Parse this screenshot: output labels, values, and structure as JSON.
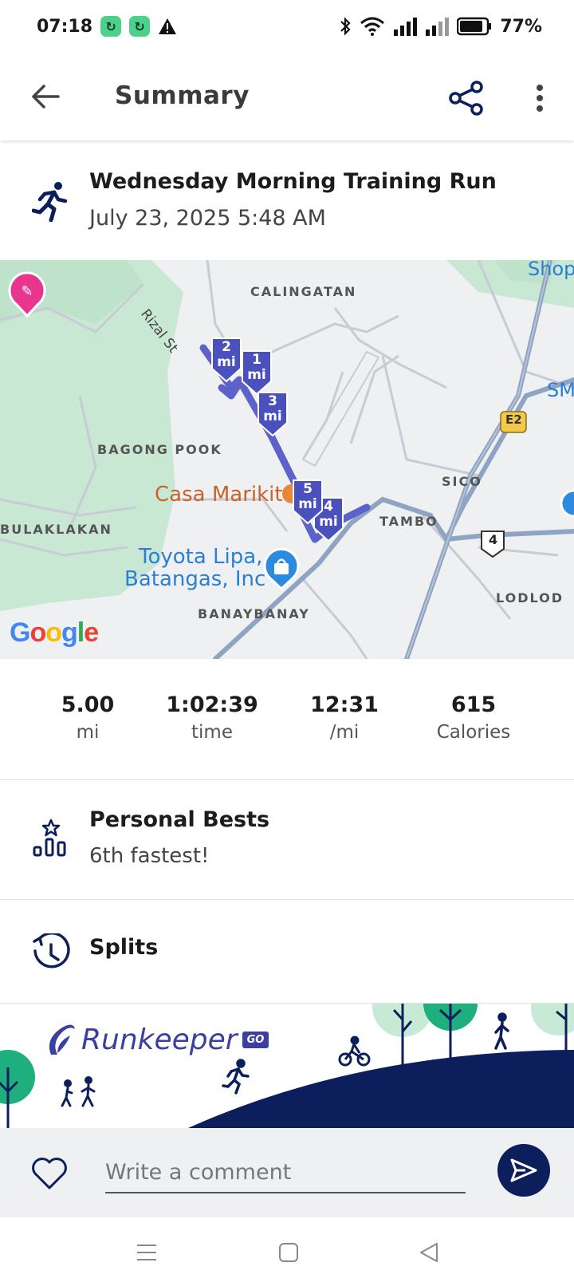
{
  "status_bar": {
    "time": "07:18",
    "battery": "77%",
    "icons": [
      "app-badge-icon",
      "app-badge-icon",
      "warning-icon",
      "bluetooth-icon",
      "wifi-icon",
      "signal-icon",
      "signal-icon",
      "battery-icon"
    ]
  },
  "app_bar": {
    "title": "Summary",
    "icons": [
      "back-arrow-icon",
      "share-icon",
      "more-vert-icon"
    ]
  },
  "activity": {
    "title": "Wednesday Morning Training Run",
    "date": "July 23, 2025 5:48 AM",
    "icon": "running-person-icon"
  },
  "map": {
    "labels": {
      "calingatan": "CALINGATAN",
      "bagong_pook": "BAGONG POOK",
      "bulaklakan": "BULAKLAKAN",
      "tambo": "TAMBO",
      "sico": "SICO",
      "lodlod": "LODLOD",
      "banaybanay": "BANAYBANAY",
      "rizal_st": "Rizal St",
      "shop": "Shop",
      "sm": "SM",
      "e2": "E2",
      "route4": "4"
    },
    "poi": {
      "casa_marikit": "Casa Marikit",
      "toyota_line1": "Toyota Lipa,",
      "toyota_line2": "Batangas, Inc"
    },
    "markers": [
      {
        "num": "1",
        "unit": "mi"
      },
      {
        "num": "2",
        "unit": "mi"
      },
      {
        "num": "3",
        "unit": "mi"
      },
      {
        "num": "4",
        "unit": "mi"
      },
      {
        "num": "5",
        "unit": "mi"
      }
    ],
    "attribution": "Google",
    "route_color": "#5c62c9"
  },
  "stats": [
    {
      "value": "5.00",
      "unit": "mi"
    },
    {
      "value": "1:02:39",
      "unit": "time"
    },
    {
      "value": "12:31",
      "unit": "/mi"
    },
    {
      "value": "615",
      "unit": "Calories"
    }
  ],
  "personal_bests": {
    "title": "Personal Bests",
    "subtitle": "6th fastest!",
    "icon": "leaderboard-star-icon"
  },
  "splits": {
    "title": "Splits",
    "icon": "stopwatch-icon"
  },
  "banner": {
    "brand": "Runkeeper",
    "badge": "GO"
  },
  "comment": {
    "placeholder": "Write a comment",
    "icons": [
      "heart-icon",
      "send-icon"
    ]
  },
  "nav": {
    "icons": [
      "menu-icon",
      "home-square-icon",
      "back-triangle-icon"
    ]
  },
  "colors": {
    "navy": "#0c1e5b",
    "accent": "#3a3fa0",
    "green": "#1fae7d"
  }
}
